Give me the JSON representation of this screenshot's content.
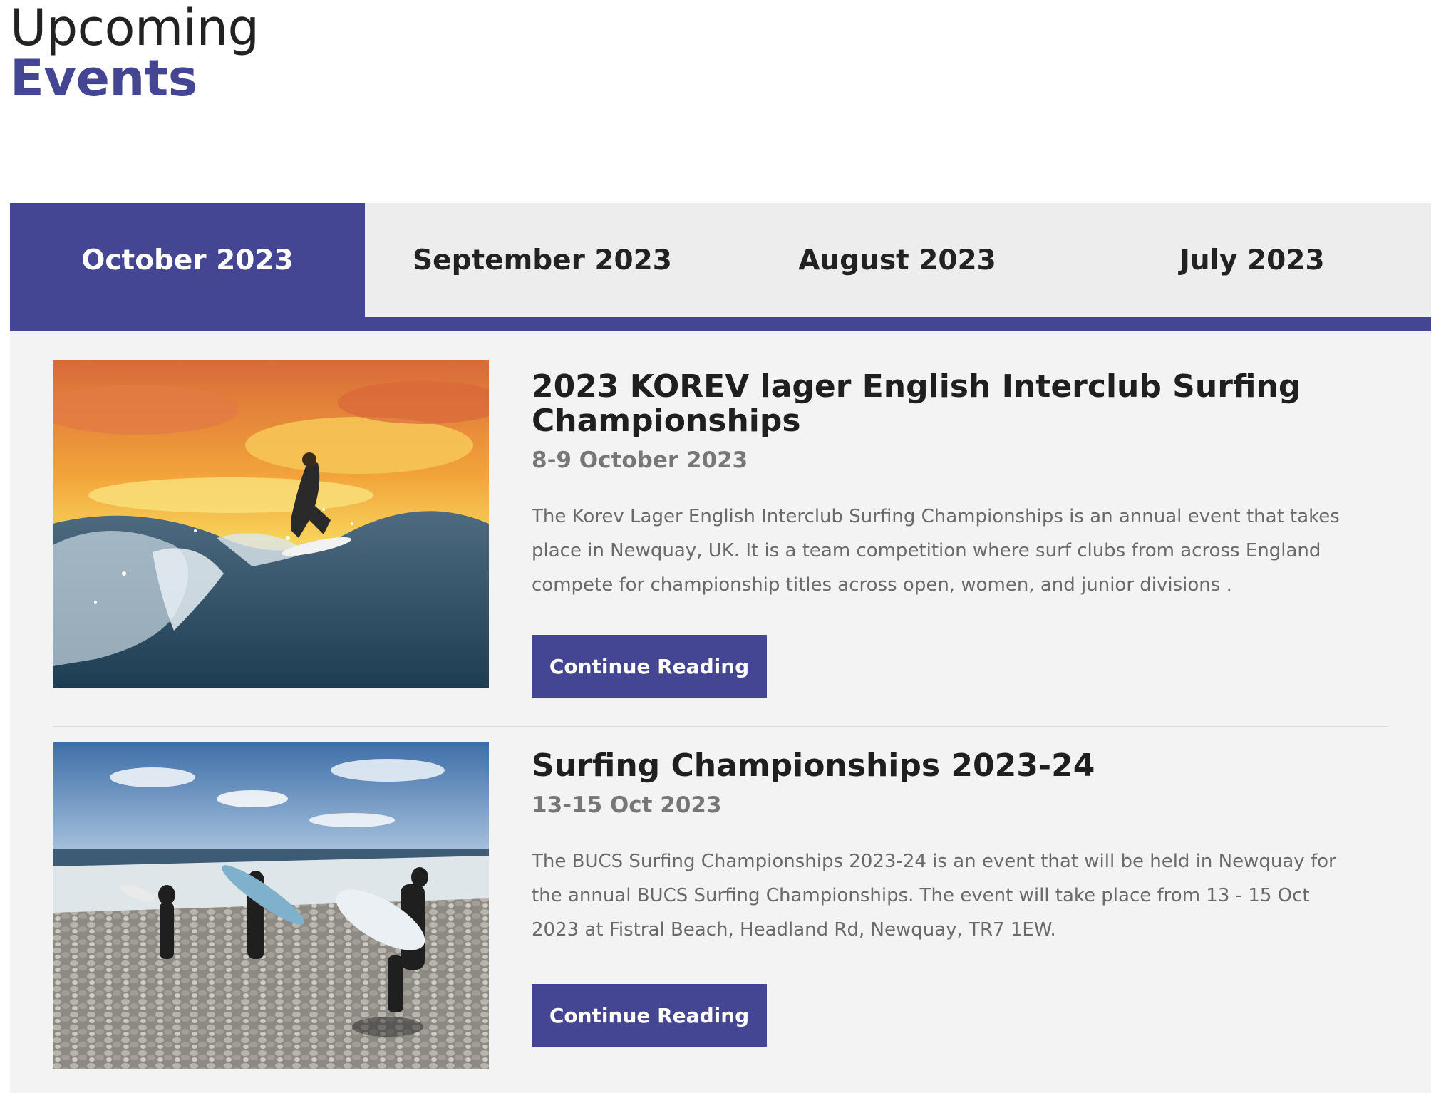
{
  "heading": {
    "line1": "Upcoming",
    "line2": "Events"
  },
  "colors": {
    "accent": "#454693",
    "tab_bg": "#ededed",
    "panel_bg": "#f3f3f3"
  },
  "tabs": [
    {
      "label": "October 2023",
      "active": true
    },
    {
      "label": "September 2023",
      "active": false
    },
    {
      "label": "August 2023",
      "active": false
    },
    {
      "label": "July 2023",
      "active": false
    }
  ],
  "events": [
    {
      "title": "2023 KOREV lager English Interclub Surfing Championships",
      "date": "8-9 October 2023",
      "description": "The Korev Lager English Interclub Surfing Championships is an annual event that takes place in Newquay, UK. It is a team competition where surf clubs from across England compete for championship titles across open, women, and junior divisions .",
      "button_label": "Continue Reading",
      "image": "surfer-on-wave-at-sunset"
    },
    {
      "title": "Surfing Championships 2023-24",
      "date": "13-15 Oct 2023",
      "description": "The BUCS Surfing Championships 2023-24 is an event that will be held in Newquay for the annual BUCS Surfing Championships. The event will take place from 13 - 15 Oct 2023 at Fistral Beach, Headland Rd, Newquay, TR7 1EW.",
      "button_label": "Continue Reading",
      "image": "surfers-walking-on-pebble-beach"
    }
  ]
}
